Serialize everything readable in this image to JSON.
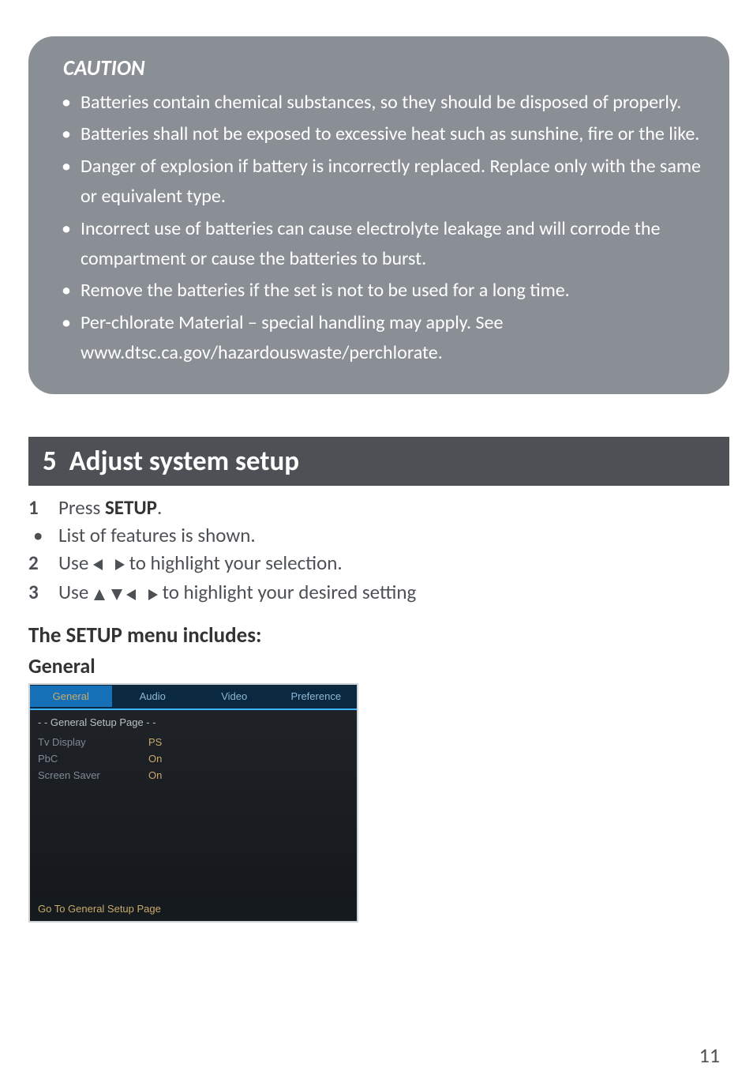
{
  "caution": {
    "title": "CAUTION",
    "items": [
      "Batteries contain chemical substances, so they should be disposed of properly.",
      "Batteries shall not be exposed to excessive heat such as sunshine, fire or the like.",
      "Danger of explosion if battery is incorrectly replaced. Replace only with the same or equivalent type.",
      "Incorrect use of batteries can cause electrolyte leakage and will corrode the compartment or cause the batteries to burst.",
      "Remove the batteries if the set is not to be used for a long time.",
      "Per-chlorate Material – special handling may apply. See www.dtsc.ca.gov/hazardouswaste/perchlorate."
    ]
  },
  "section": {
    "number": "5",
    "title": "Adjust system setup"
  },
  "steps": {
    "s1_num": "1",
    "s1_pre": "Press ",
    "s1_bold": "SETUP",
    "s1_post": ".",
    "s1b": "List of features is shown.",
    "s2_num": "2",
    "s2_pre": "Use ",
    "s2_post": " to highlight your selection.",
    "s3_num": "3",
    "s3_pre": "Use ",
    "s3_post": " to highlight your desired setting"
  },
  "sub1": "The SETUP menu includes:",
  "sub2": "General",
  "menu": {
    "tabs": [
      "General",
      "Audio",
      "Video",
      "Preference"
    ],
    "body_title": "- -  General Setup Page  - -",
    "rows": [
      {
        "label": "Tv  Display",
        "value": "PS"
      },
      {
        "label": "PbC",
        "value": "On"
      },
      {
        "label": "Screen Saver",
        "value": "On"
      }
    ],
    "footer": "Go  To  General  Setup  Page"
  },
  "page_number": "11"
}
